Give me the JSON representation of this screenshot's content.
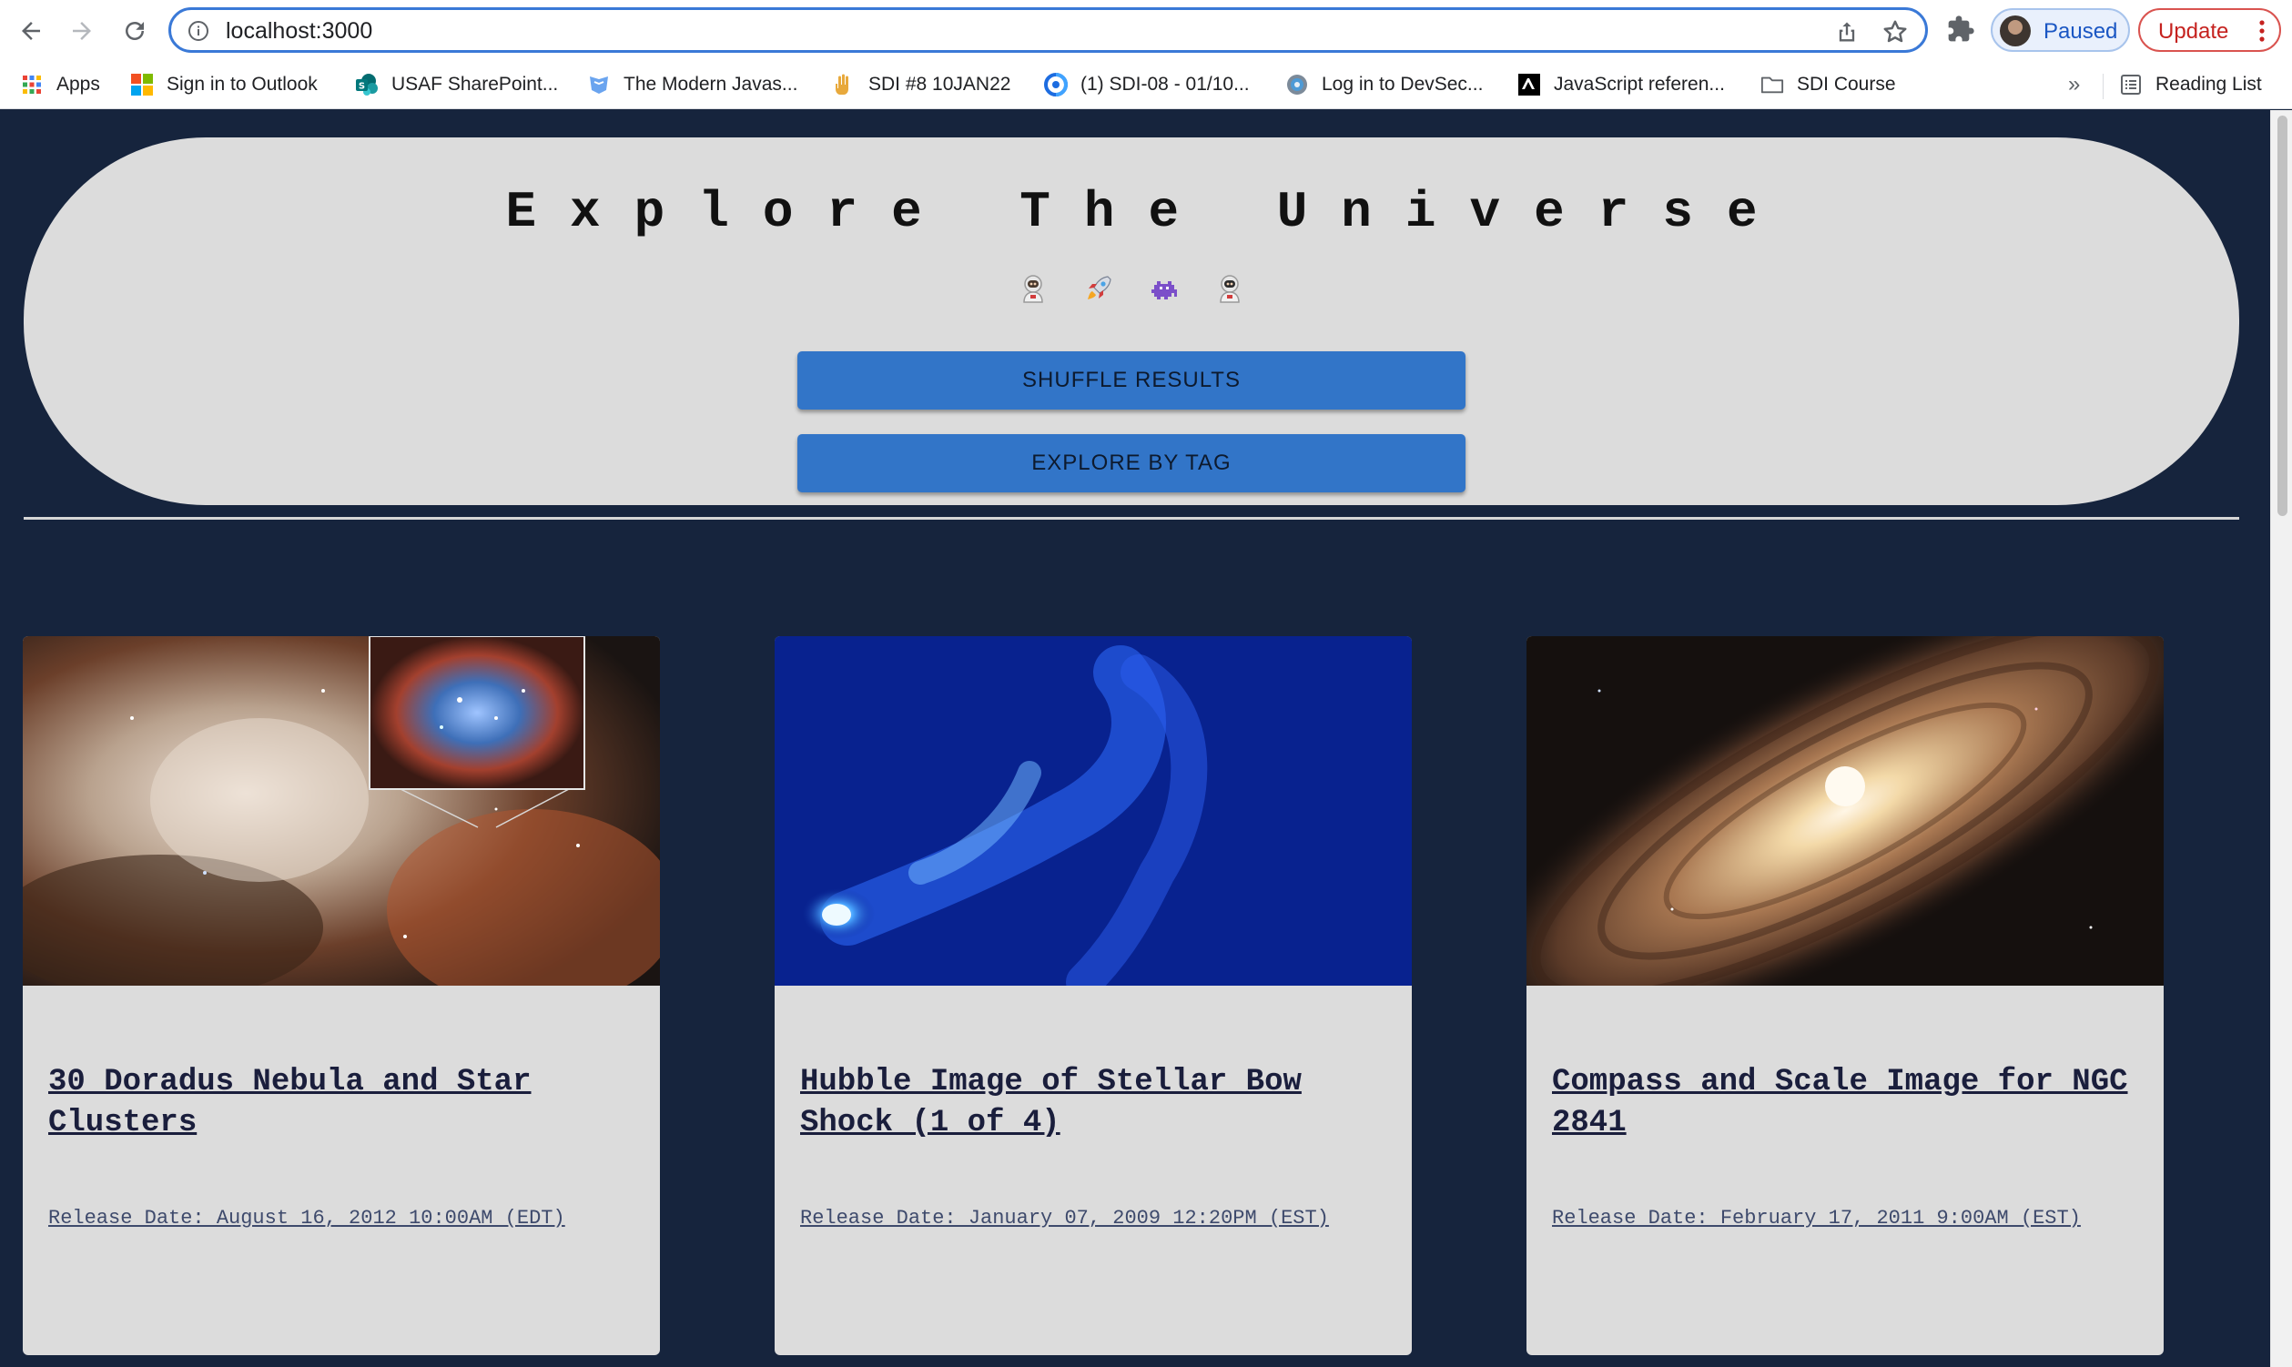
{
  "browser": {
    "url": "localhost:3000",
    "profile_label": "Paused",
    "update_label": "Update",
    "bookmarks": [
      {
        "label": "Apps",
        "icon": "apps-grid-icon"
      },
      {
        "label": "Sign in to Outlook",
        "icon": "microsoft-icon"
      },
      {
        "label": "USAF SharePoint...",
        "icon": "sharepoint-icon"
      },
      {
        "label": "The Modern Javas...",
        "icon": "javascript-info-icon"
      },
      {
        "label": "SDI #8 10JAN22",
        "icon": "hand-icon"
      },
      {
        "label": "(1) SDI-08 - 01/10...",
        "icon": "webex-icon"
      },
      {
        "label": "Log in to DevSec...",
        "icon": "devsecops-icon"
      },
      {
        "label": "JavaScript referen...",
        "icon": "mdn-icon"
      },
      {
        "label": "SDI Course",
        "icon": "folder-icon"
      }
    ],
    "more_label": "»",
    "reading_list_label": "Reading List"
  },
  "hero": {
    "title": "Explore The Universe",
    "emojis": [
      "astronaut-icon",
      "rocket-icon",
      "alien-monster-icon",
      "astronaut-icon"
    ],
    "shuffle_label": "SHUFFLE RESULTS",
    "explore_label": "EXPLORE BY TAG"
  },
  "cards": [
    {
      "title": "30 Doradus Nebula and Star Clusters",
      "date": "Release Date: August 16, 2012 10:00AM (EDT)",
      "image": "nebula-image"
    },
    {
      "title": "Hubble Image of Stellar Bow Shock (1 of 4)",
      "date": "Release Date: January 07, 2009 12:20PM (EST)",
      "image": "bow-shock-image"
    },
    {
      "title": "Compass and Scale Image for NGC 2841",
      "date": "Release Date: February 17, 2011 9:00AM (EST)",
      "image": "galaxy-image"
    }
  ],
  "colors": {
    "page_bg": "#16243d",
    "hero_bg": "#dcdcdc",
    "button_bg": "#3275c8",
    "card_bg": "#dcdcdc"
  }
}
